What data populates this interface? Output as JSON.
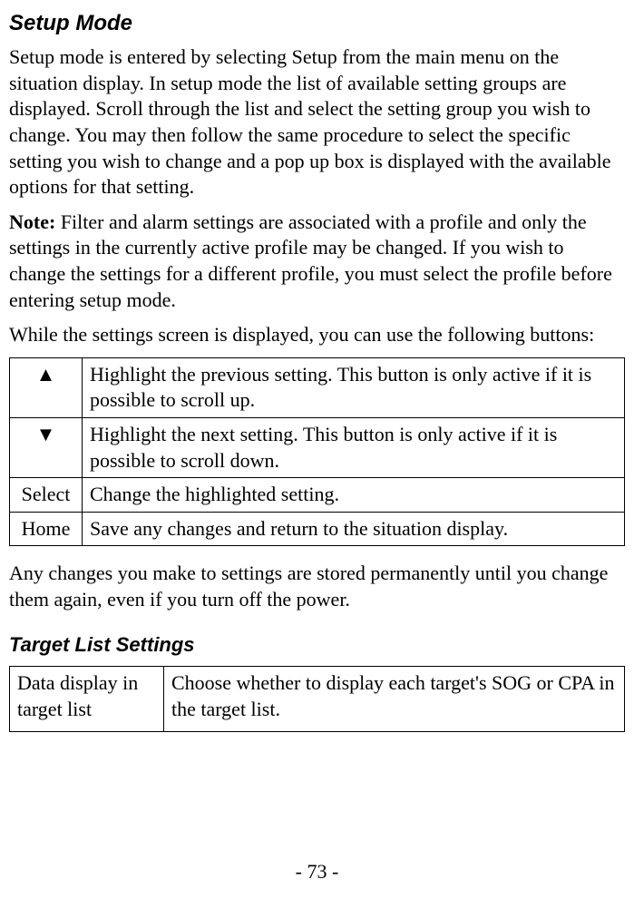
{
  "section1": {
    "title": "Setup Mode",
    "para1": "Setup mode is entered by selecting Setup from the main menu on the situation display. In setup mode the list of available setting groups are displayed. Scroll through the list and select the setting group you wish to change. You may then follow the same procedure to select the specific setting you wish to change and a pop up box is displayed with the available options for that setting.",
    "noteLabel": "Note:",
    "noteText": " Filter and alarm settings are associated with a profile and only the settings in the currently active profile may be changed. If you wish to change the settings for a different profile, you must select the profile before entering setup mode.",
    "para3": "While the settings screen is displayed, you can use the following buttons:"
  },
  "buttonsTable": [
    {
      "btn": "▲",
      "desc": "Highlight the previous setting. This button is only active if it is possible to scroll up."
    },
    {
      "btn": "▼",
      "desc": "Highlight the next setting. This button is only active if it is possible to scroll down."
    },
    {
      "btn": "Select",
      "desc": "Change the highlighted setting."
    },
    {
      "btn": "Home",
      "desc": "Save any changes and return to the situation display."
    }
  ],
  "para4": "Any changes you make to settings are stored permanently until you change them again, even if you turn off the power.",
  "section2": {
    "title": "Target List Settings"
  },
  "targetTable": [
    {
      "setting": "Data display in target list",
      "desc": "Choose whether to display each target's SOG or CPA in the target list."
    }
  ],
  "pageNumber": "- 73 -"
}
